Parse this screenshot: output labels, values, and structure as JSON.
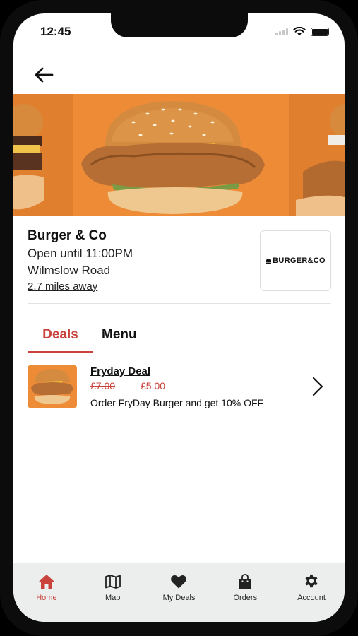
{
  "status_bar": {
    "time": "12:45"
  },
  "restaurant": {
    "name": "Burger & Co",
    "hours": "Open until 11:00PM",
    "address": "Wilmslow Road",
    "distance": "2.7 miles away",
    "logo_text": "BURGER&CO"
  },
  "tabs": [
    {
      "label": "Deals",
      "active": true
    },
    {
      "label": "Menu",
      "active": false
    }
  ],
  "deals": [
    {
      "title": "Fryday Deal",
      "old_price": "£7.00",
      "new_price": "£5.00",
      "description": "Order FryDay Burger and get 10% OFF"
    }
  ],
  "tab_bar": [
    {
      "label": "Home",
      "icon": "home-icon",
      "active": true
    },
    {
      "label": "Map",
      "icon": "map-icon",
      "active": false
    },
    {
      "label": "My Deals",
      "icon": "heart-icon",
      "active": false
    },
    {
      "label": "Orders",
      "icon": "shopping-bag-icon",
      "active": false
    },
    {
      "label": "Account",
      "icon": "gear-icon",
      "active": false
    }
  ],
  "colors": {
    "accent": "#c9433c",
    "hero_background": "#ee8b37",
    "tab_bar_background": "#eceeee"
  }
}
